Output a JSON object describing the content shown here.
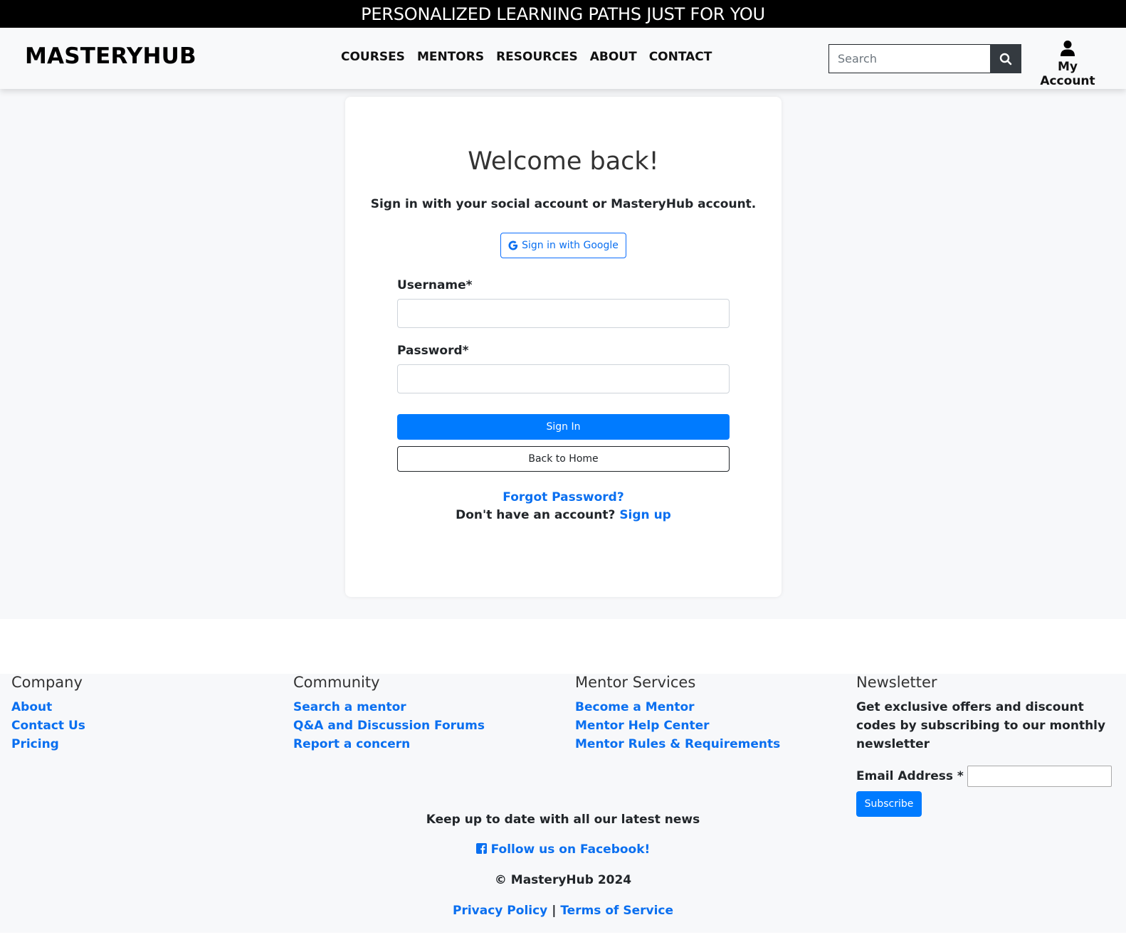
{
  "promo": {
    "text": "PERSONALIZED LEARNING PATHS JUST FOR YOU"
  },
  "header": {
    "brand": "MASTERYHUB",
    "nav": [
      "COURSES",
      "MENTORS",
      "RESOURCES",
      "ABOUT",
      "CONTACT"
    ],
    "search_placeholder": "Search",
    "account_label": "My Account"
  },
  "login": {
    "title": "Welcome back!",
    "subtitle": "Sign in with your social account or MasteryHub account.",
    "google_label": "Sign in with Google",
    "username_label": "Username*",
    "username_value": "",
    "password_label": "Password*",
    "password_value": "",
    "signin_label": "Sign In",
    "home_label": "Back to Home",
    "forgot_label": "Forgot Password?",
    "no_account_text": "Don't have an account?",
    "signup_label": "Sign up"
  },
  "footer": {
    "company": {
      "heading": "Company",
      "links": [
        "About",
        "Contact Us",
        "Pricing"
      ]
    },
    "community": {
      "heading": "Community",
      "links": [
        "Search a mentor",
        "Q&A and Discussion Forums",
        "Report a concern"
      ]
    },
    "mentor_services": {
      "heading": "Mentor Services",
      "links": [
        "Become a Mentor",
        "Mentor Help Center",
        "Mentor Rules & Requirements"
      ]
    },
    "newsletter": {
      "heading": "Newsletter",
      "text": "Get exclusive offers and discount codes by subscribing to our monthly newsletter",
      "email_label": "Email Address *",
      "email_value": "",
      "subscribe_label": "Subscribe"
    },
    "tagline": "Keep up to date with all our latest news",
    "facebook_label": "Follow us on Facebook!",
    "copyright": "© MasteryHub 2024",
    "privacy_label": "Privacy Policy",
    "separator": "|",
    "terms_label": "Terms of Service"
  },
  "colors": {
    "primary": "#007bff",
    "link": "#0a6ff0",
    "promo_bg": "#000000",
    "search_btn": "#343a40"
  },
  "icons": {
    "search": "search-icon",
    "account": "user-icon",
    "google": "google-icon",
    "facebook": "facebook-icon"
  }
}
